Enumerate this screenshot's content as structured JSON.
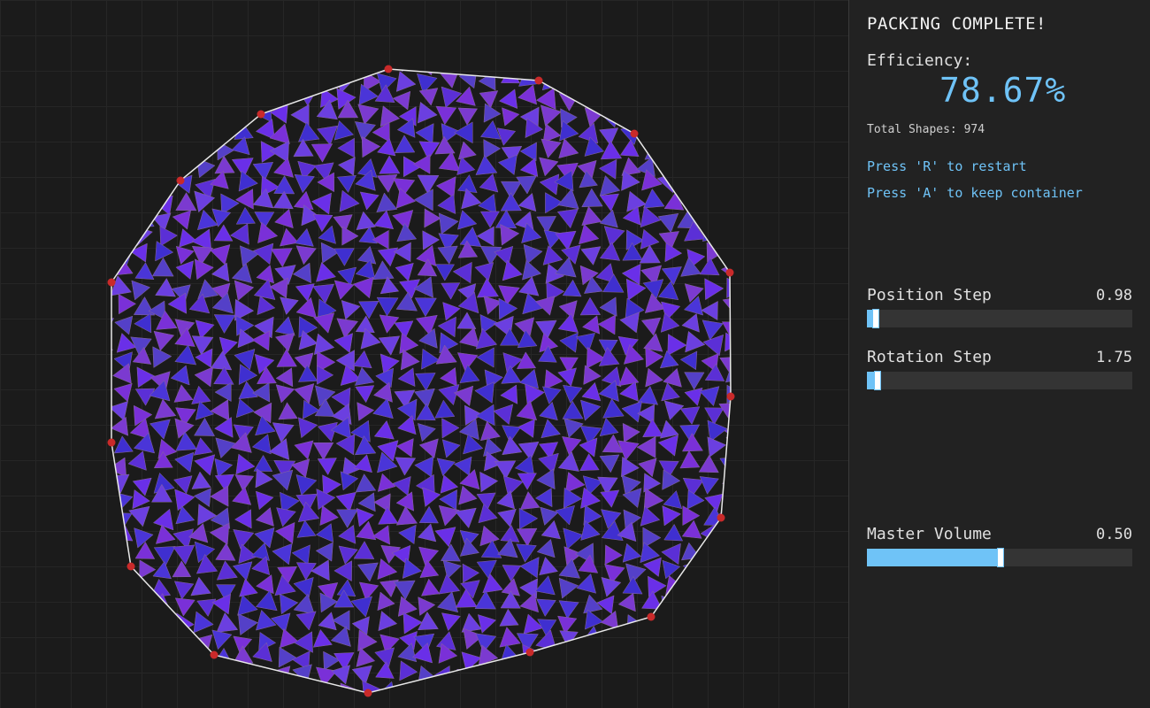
{
  "colors": {
    "accent": "#6fc3f7",
    "vertex": "#c92a2a",
    "container_outline": "#e8e8e8",
    "shape_palette": [
      "#5b2fd6",
      "#6a2fe8",
      "#4a35d8",
      "#7a30d8",
      "#3f2fd0",
      "#6b3fe0",
      "#5440c8",
      "#7b3ad0"
    ]
  },
  "status": {
    "title": "PACKING COMPLETE!",
    "efficiency_label": "Efficiency:",
    "efficiency_value": "78.67%",
    "total_shapes": "Total Shapes: 974"
  },
  "hints": [
    "Press 'R' to restart",
    "Press 'A' to keep container"
  ],
  "sliders": {
    "position_step": {
      "label": "Position Step",
      "value": "0.98",
      "fraction": 0.03
    },
    "rotation_step": {
      "label": "Rotation Step",
      "value": "1.75",
      "fraction": 0.035
    },
    "master_volume": {
      "label": "Master Volume",
      "value": "0.50",
      "fraction": 0.5
    }
  }
}
